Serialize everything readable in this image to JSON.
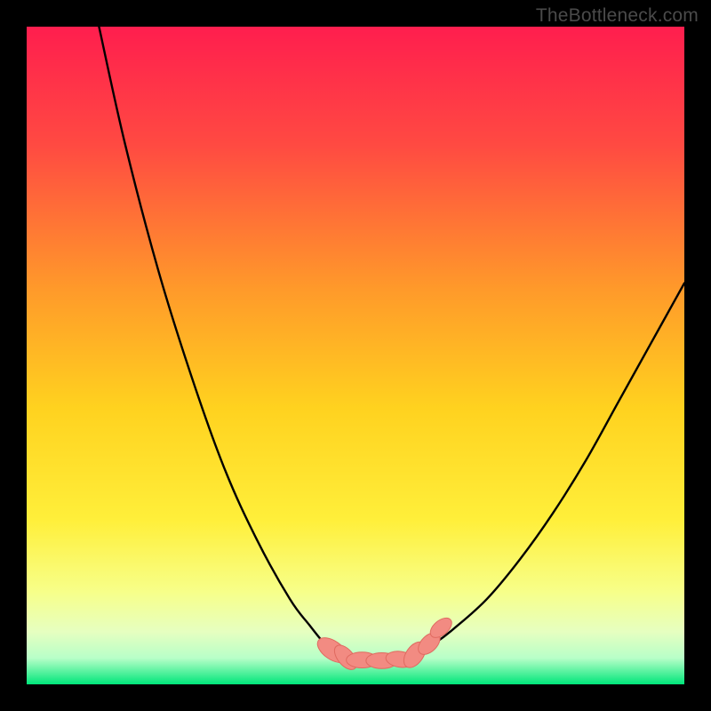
{
  "watermark": "TheBottleneck.com",
  "colors": {
    "gradient_top": "#ff1e4e",
    "gradient_mid_upper": "#ff7a3a",
    "gradient_mid": "#ffd21f",
    "gradient_lower": "#f7ff6e",
    "gradient_pale": "#e8ffd0",
    "gradient_bottom": "#00e67a",
    "curve": "#000000",
    "marker_fill": "#f28b82",
    "marker_stroke": "#e06a60",
    "frame": "#000000"
  },
  "chart_data": {
    "type": "line",
    "title": "",
    "xlabel": "",
    "ylabel": "",
    "xlim": [
      0,
      100
    ],
    "ylim": [
      0,
      100
    ],
    "series": [
      {
        "name": "left-branch",
        "x": [
          11,
          15,
          20,
          25,
          30,
          35,
          40,
          43,
          45,
          46,
          47,
          48
        ],
        "y": [
          100,
          82,
          63,
          47,
          33,
          22,
          13,
          9,
          6.5,
          5.5,
          4.8,
          4.2
        ]
      },
      {
        "name": "valley-floor",
        "x": [
          48,
          50,
          52,
          54,
          56,
          58,
          60
        ],
        "y": [
          4.2,
          3.8,
          3.6,
          3.6,
          3.8,
          4.2,
          5.0
        ]
      },
      {
        "name": "right-branch",
        "x": [
          60,
          62,
          65,
          70,
          75,
          80,
          85,
          90,
          95,
          100
        ],
        "y": [
          5.0,
          6.2,
          8.5,
          13,
          19,
          26,
          34,
          43,
          52,
          61
        ]
      }
    ],
    "markers": {
      "name": "bottleneck-cluster",
      "points": [
        {
          "x": 46.5,
          "y": 5.2,
          "rx": 1.4,
          "ry": 2.6,
          "rot": -55
        },
        {
          "x": 48.5,
          "y": 4.1,
          "rx": 1.2,
          "ry": 2.2,
          "rot": -40
        },
        {
          "x": 51.0,
          "y": 3.7,
          "rx": 2.4,
          "ry": 1.2,
          "rot": 0
        },
        {
          "x": 54.0,
          "y": 3.6,
          "rx": 2.4,
          "ry": 1.2,
          "rot": 0
        },
        {
          "x": 56.8,
          "y": 3.8,
          "rx": 2.2,
          "ry": 1.2,
          "rot": 8
        },
        {
          "x": 59.0,
          "y": 4.5,
          "rx": 1.3,
          "ry": 2.2,
          "rot": 35
        },
        {
          "x": 61.2,
          "y": 6.2,
          "rx": 1.2,
          "ry": 2.0,
          "rot": 45
        },
        {
          "x": 63.0,
          "y": 8.6,
          "rx": 1.1,
          "ry": 1.9,
          "rot": 50
        }
      ]
    }
  }
}
